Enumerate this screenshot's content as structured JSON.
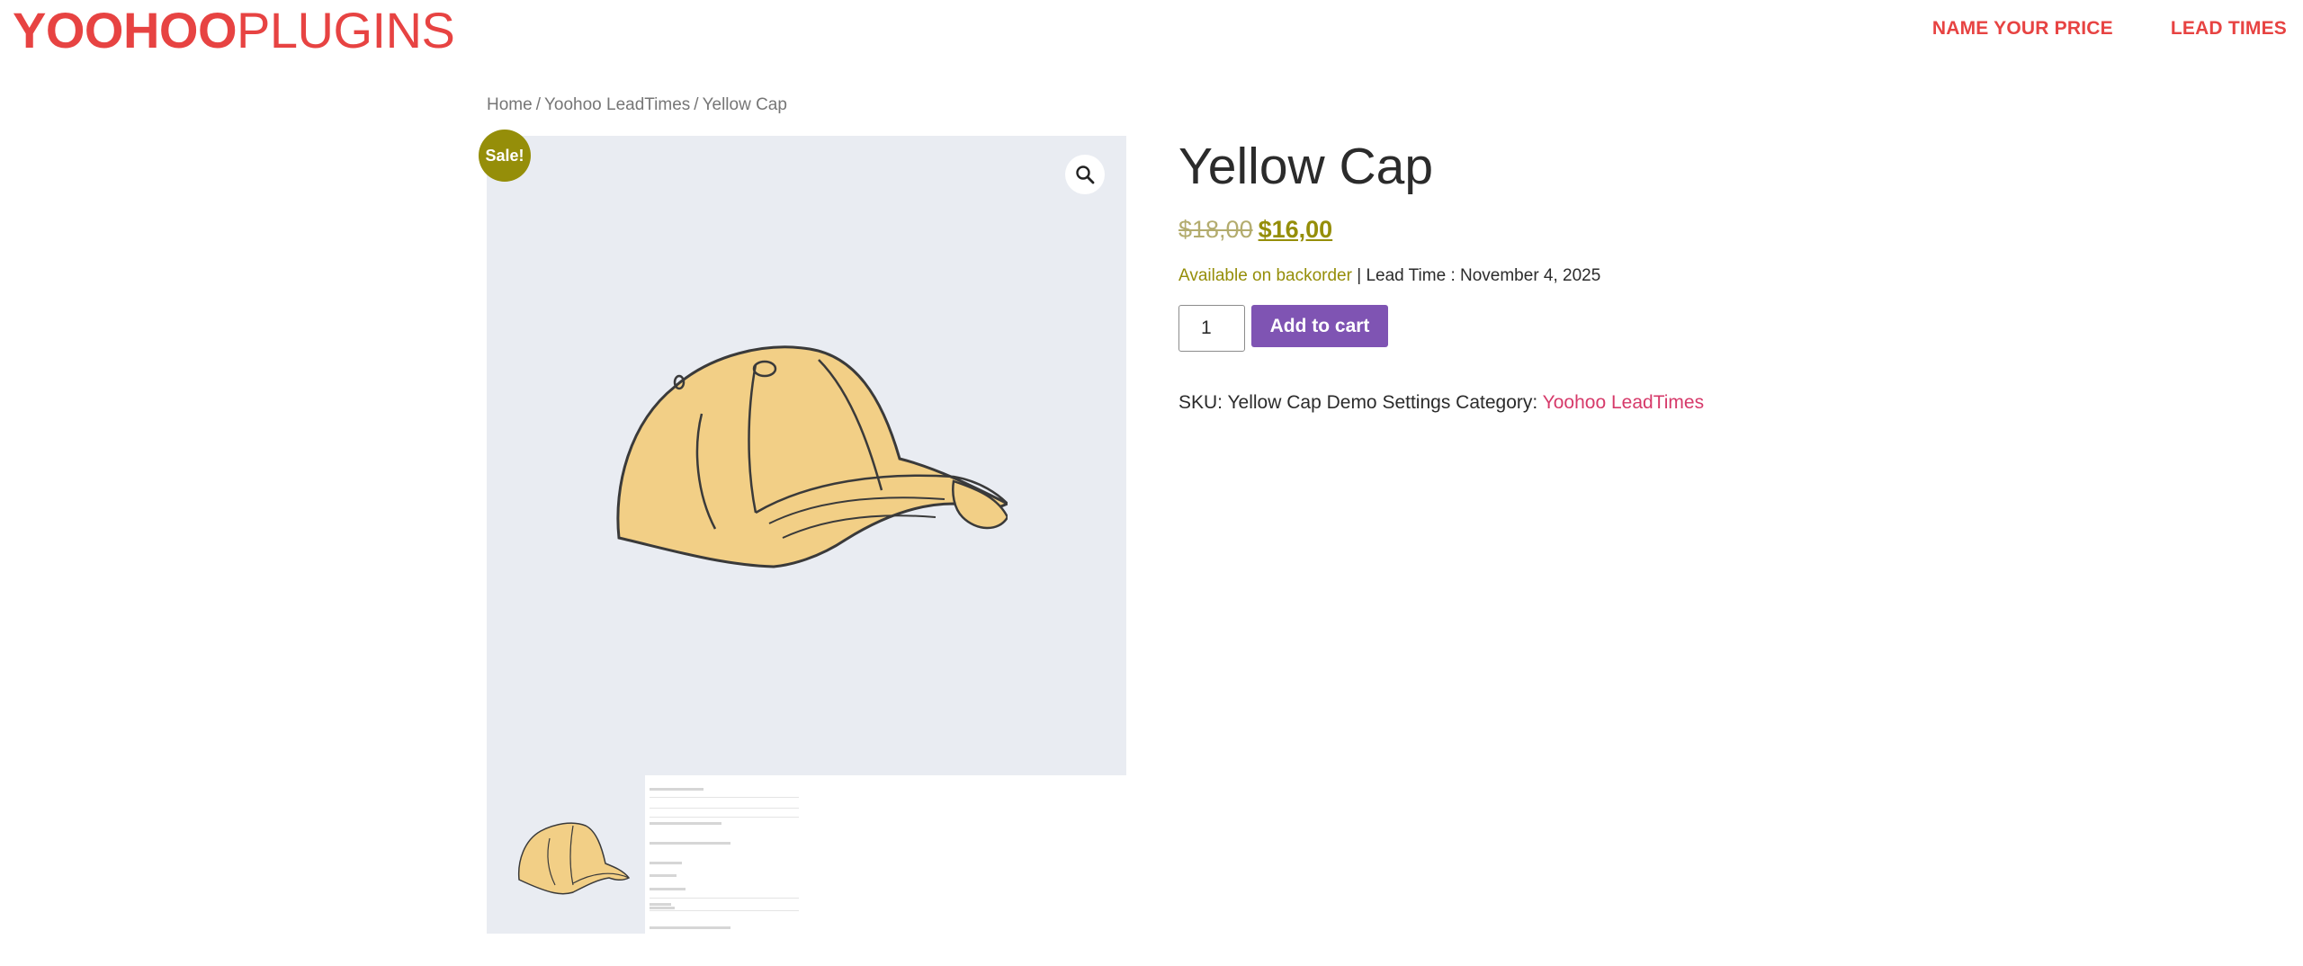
{
  "header": {
    "logo_bold": "YOOHOO",
    "logo_light": "PLUGINS",
    "nav": [
      {
        "label": "NAME YOUR PRICE"
      },
      {
        "label": "LEAD TIMES"
      }
    ]
  },
  "breadcrumb": {
    "items": [
      "Home",
      "Yoohoo LeadTimes",
      "Yellow Cap"
    ],
    "separator": "/"
  },
  "gallery": {
    "sale_label": "Sale!",
    "zoom_icon": "magnifier-icon"
  },
  "product": {
    "title": "Yellow Cap",
    "old_price": "$18,00",
    "new_price": "$16,00",
    "availability": "Available on backorder",
    "lead_time": " | Lead Time : November 4, 2025",
    "quantity": "1",
    "add_to_cart": "Add to cart",
    "meta_prefix": "SKU: Yellow Cap Demo Settings Category: ",
    "category": "Yoohoo LeadTimes"
  },
  "colors": {
    "brand": "#e74342",
    "sale": "#958e09",
    "button": "#7f54b3",
    "link": "#d63a6a",
    "gallery_bg": "#e9ecf2"
  }
}
